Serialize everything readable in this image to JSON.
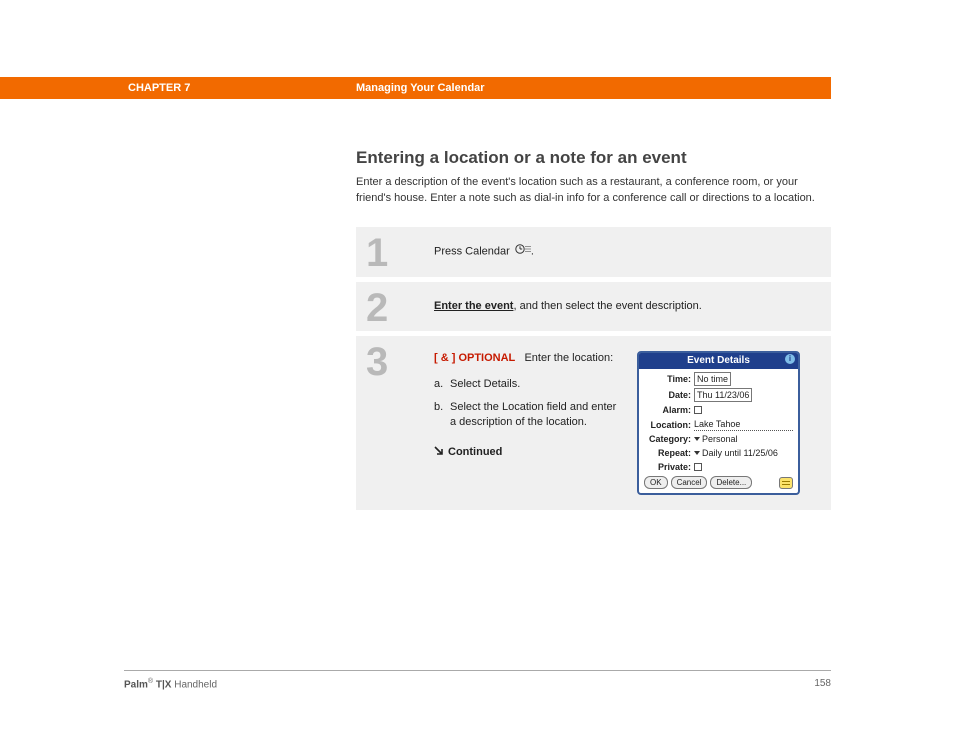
{
  "header": {
    "chapter": "CHAPTER 7",
    "title": "Managing Your Calendar"
  },
  "section": {
    "title": "Entering a location or a note for an event",
    "description": "Enter a description of the event's location such as a restaurant, a conference room, or your friend's house. Enter a note such as dial-in info for a conference call or directions to a location."
  },
  "steps": {
    "one": {
      "num": "1",
      "text_a": "Press Calendar ",
      "text_b": "."
    },
    "two": {
      "num": "2",
      "link": "Enter the event",
      "rest": ", and then select the event description."
    },
    "three": {
      "num": "3",
      "tag": "[ & ]  OPTIONAL",
      "intro": "Enter the location:",
      "a_letter": "a.",
      "a_text": "Select Details.",
      "b_letter": "b.",
      "b_text": "Select the Location field and enter a description of the location.",
      "continued": "Continued"
    }
  },
  "dialog": {
    "title": "Event Details",
    "rows": {
      "time": {
        "label": "Time:",
        "value": "No time"
      },
      "date": {
        "label": "Date:",
        "value": "Thu 11/23/06"
      },
      "alarm": {
        "label": "Alarm:"
      },
      "location": {
        "label": "Location:",
        "value": "Lake Tahoe"
      },
      "category": {
        "label": "Category:",
        "value": "Personal"
      },
      "repeat": {
        "label": "Repeat:",
        "value": "Daily until 11/25/06"
      },
      "private": {
        "label": "Private:"
      }
    },
    "buttons": {
      "ok": "OK",
      "cancel": "Cancel",
      "delete": "Delete..."
    }
  },
  "footer": {
    "brand_a": "Palm",
    "brand_reg": "®",
    "brand_b": " T|X",
    "brand_c": " Handheld",
    "page": "158"
  }
}
